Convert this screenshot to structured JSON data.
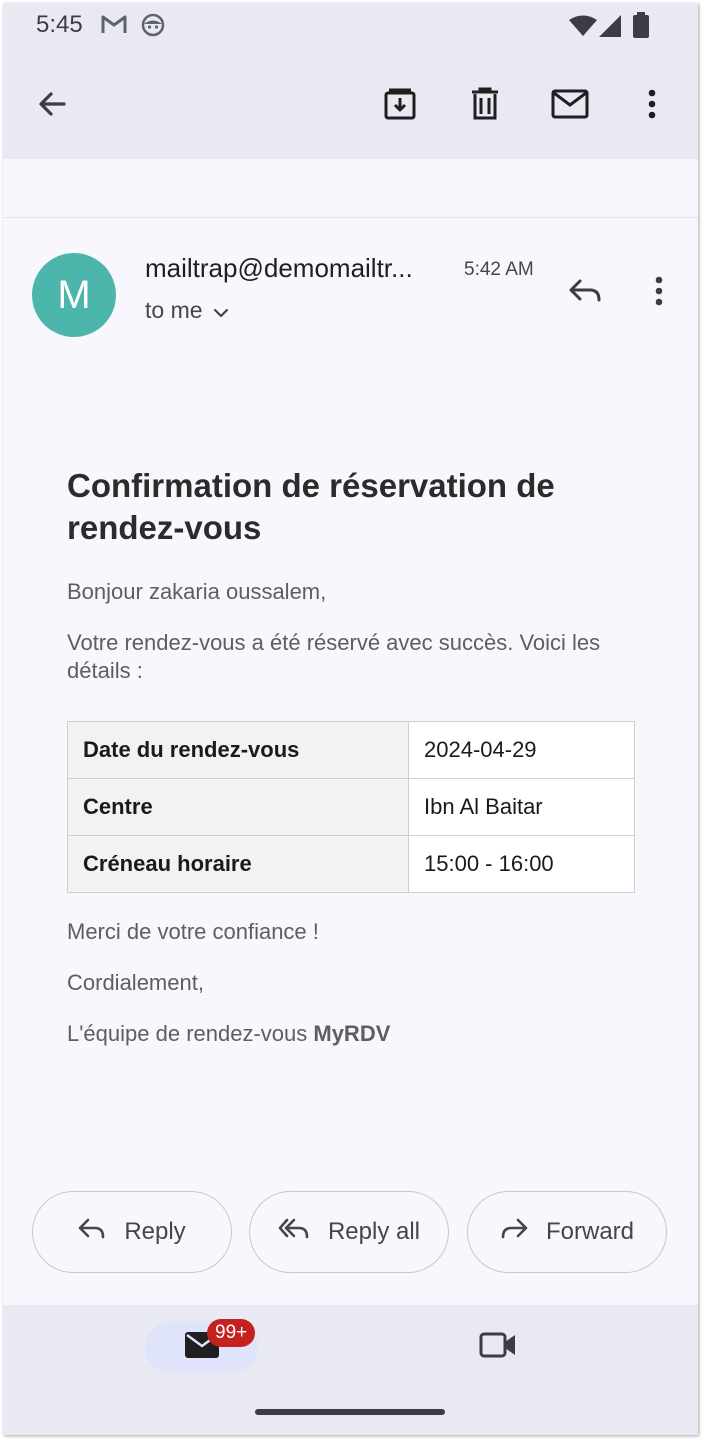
{
  "status_bar": {
    "time": "5:45",
    "left_icons": [
      "gmail-icon",
      "android-face-icon"
    ],
    "right_icons": [
      "wifi-icon",
      "cell-signal-icon",
      "battery-icon"
    ]
  },
  "toolbar": {
    "icons": [
      "back-arrow-icon",
      "archive-icon",
      "delete-icon",
      "mark-unread-icon",
      "more-vert-icon"
    ]
  },
  "email": {
    "avatar_letter": "M",
    "sender": "mailtrap@demomailtr...",
    "time": "5:42 AM",
    "recipient": "to me",
    "title": "Confirmation de réservation de rendez-vous",
    "greeting": "Bonjour zakaria oussalem,",
    "intro": "Votre rendez-vous a été réservé avec succès. Voici les détails :",
    "details": [
      {
        "label": "Date du rendez-vous",
        "value": "2024-04-29"
      },
      {
        "label": "Centre",
        "value": "Ibn Al Baitar"
      },
      {
        "label": "Créneau horaire",
        "value": "15:00 - 16:00"
      }
    ],
    "thanks": "Merci de votre confiance !",
    "closing": "Cordialement,",
    "signature_prefix": "L'équipe de rendez-vous ",
    "signature_brand": "MyRDV"
  },
  "actions": {
    "reply": "Reply",
    "reply_all": "Reply all",
    "forward": "Forward"
  },
  "bottom_nav": {
    "mail_badge": "99+",
    "accent": "#dfe4fb",
    "badge_color": "#c5221f"
  },
  "colors": {
    "avatar": "#4db6ac",
    "background": "#f7f7fd",
    "bars": "#e9e9f3"
  }
}
